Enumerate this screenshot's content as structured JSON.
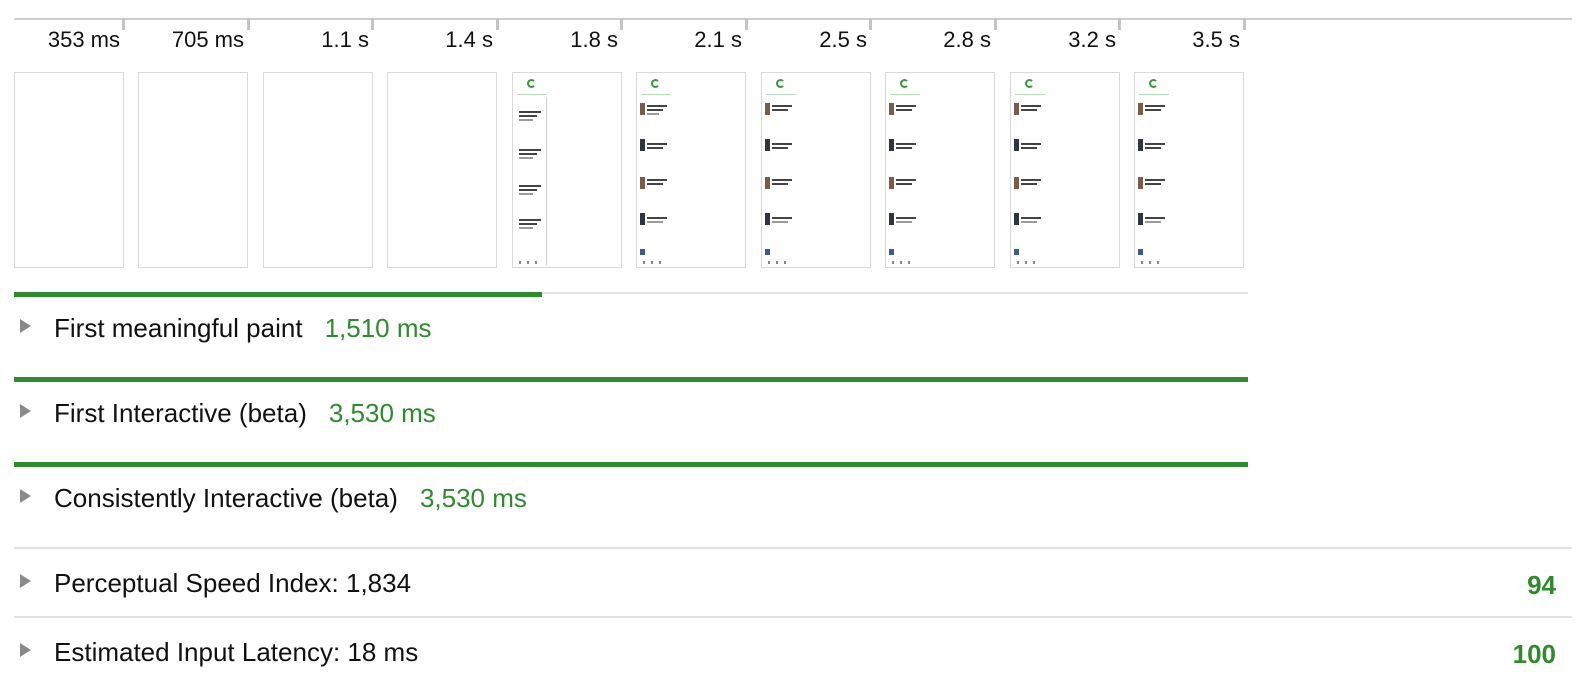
{
  "timeline": {
    "ticks": [
      "353 ms",
      "705 ms",
      "1.1 s",
      "1.4 s",
      "1.8 s",
      "2.1 s",
      "2.5 s",
      "2.8 s",
      "3.2 s",
      "3.5 s"
    ],
    "frames": [
      {
        "state": "blank"
      },
      {
        "state": "blank"
      },
      {
        "state": "blank"
      },
      {
        "state": "blank"
      },
      {
        "state": "partial"
      },
      {
        "state": "loaded"
      },
      {
        "state": "loaded"
      },
      {
        "state": "loaded"
      },
      {
        "state": "loaded"
      },
      {
        "state": "loaded"
      }
    ]
  },
  "metrics": [
    {
      "title": "First meaningful paint",
      "value": "1,510 ms",
      "bar_fraction": 0.428
    },
    {
      "title": "First Interactive (beta)",
      "value": "3,530 ms",
      "bar_fraction": 1.0
    },
    {
      "title": "Consistently Interactive (beta)",
      "value": "3,530 ms",
      "bar_fraction": 1.0
    }
  ],
  "scored_metrics": [
    {
      "label": "Perceptual Speed Index: 1,834",
      "score": "94"
    },
    {
      "label": "Estimated Input Latency: 18 ms",
      "score": "100"
    }
  ],
  "colors": {
    "accent": "#2e8b2e",
    "text": "#111111",
    "caret": "#8a8a8a",
    "divider": "#e2e2e2"
  }
}
